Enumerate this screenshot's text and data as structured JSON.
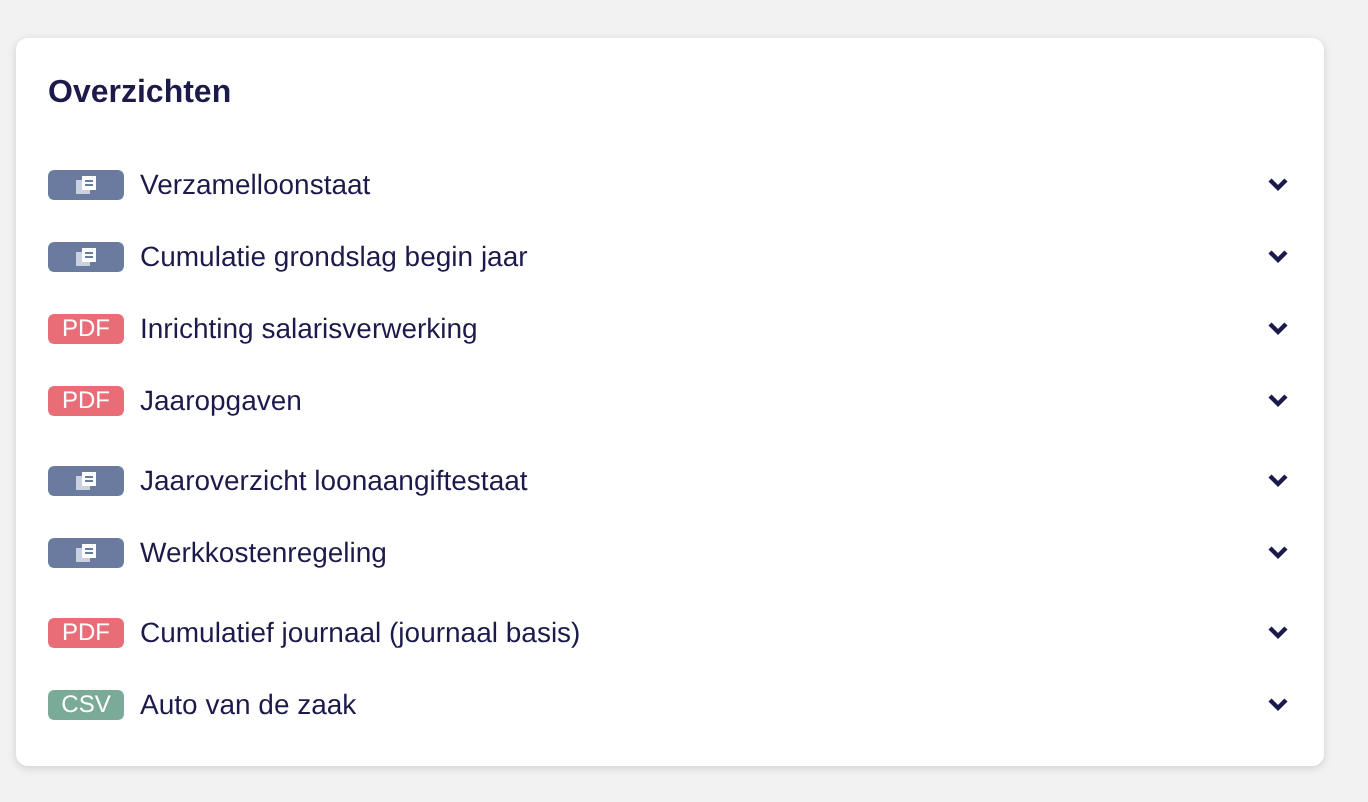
{
  "title": "Overzichten",
  "groups": [
    {
      "items": [
        {
          "kind": "report",
          "label": "Verzamelloonstaat",
          "expanded": false
        },
        {
          "kind": "report",
          "label": "Cumulatie grondslag begin jaar",
          "expanded": false
        },
        {
          "kind": "pdf",
          "badge": "PDF",
          "label": "Inrichting salarisverwerking",
          "expanded": false
        },
        {
          "kind": "pdf",
          "badge": "PDF",
          "label": "Jaaropgaven",
          "expanded": false
        }
      ]
    },
    {
      "items": [
        {
          "kind": "report",
          "label": "Jaaroverzicht loonaangiftestaat",
          "expanded": false
        },
        {
          "kind": "report",
          "label": "Werkkostenregeling",
          "expanded": false
        }
      ]
    },
    {
      "items": [
        {
          "kind": "pdf",
          "badge": "PDF",
          "label": "Cumulatief journaal (journaal basis)",
          "expanded": false
        },
        {
          "kind": "csv",
          "badge": "CSV",
          "label": "Auto van de zaak",
          "expanded": false
        }
      ]
    }
  ]
}
